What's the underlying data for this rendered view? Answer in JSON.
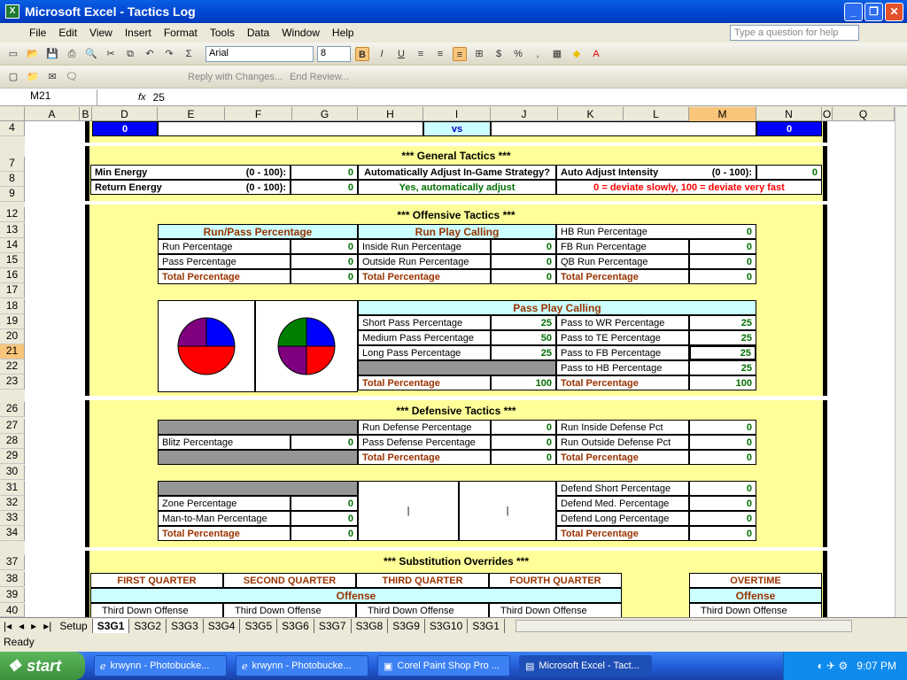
{
  "window": {
    "title": "Microsoft Excel - Tactics Log",
    "help_placeholder": "Type a question for help"
  },
  "menu": [
    "File",
    "Edit",
    "View",
    "Insert",
    "Format",
    "Tools",
    "Data",
    "Window",
    "Help"
  ],
  "toolbar": {
    "font": "Arial",
    "size": "8",
    "review": "Reply with Changes...",
    "end_review": "End Review..."
  },
  "formula": {
    "cell": "M21",
    "fx": "fx",
    "value": "25"
  },
  "columns": [
    "A",
    "B",
    "D",
    "E",
    "F",
    "G",
    "H",
    "I",
    "J",
    "K",
    "L",
    "M",
    "N",
    "O",
    "Q"
  ],
  "rows": [
    "4",
    "7",
    "8",
    "9",
    "12",
    "13",
    "14",
    "15",
    "16",
    "17",
    "18",
    "19",
    "20",
    "21",
    "22",
    "23",
    "26",
    "27",
    "28",
    "29",
    "30",
    "31",
    "32",
    "33",
    "34",
    "37",
    "38",
    "39",
    "40"
  ],
  "score": {
    "home": "0",
    "vs": "vs",
    "away": "0"
  },
  "general": {
    "title": "*** General Tactics ***",
    "min_energy": "Min Energy",
    "range1": "(0 - 100):",
    "return_energy": "Return Energy",
    "range2": "(0 - 100):",
    "min_val": "0",
    "ret_val": "0",
    "auto_q": "Automatically Adjust In-Game Strategy?",
    "auto_a": "Yes, automatically adjust",
    "intensity": "Auto Adjust Intensity",
    "range3": "(0 - 100):",
    "intensity_val": "0",
    "note": "0 = deviate slowly, 100 = deviate very fast"
  },
  "offense": {
    "title": "*** Offensive Tactics ***",
    "runpass_hdr": "Run/Pass Percentage",
    "runplay_hdr": "Run Play Calling",
    "run_pct": "Run Percentage",
    "pass_pct": "Pass Percentage",
    "total": "Total Percentage",
    "inside": "Inside Run Percentage",
    "outside": "Outside Run Percentage",
    "hb": "HB Run Percentage",
    "fb": "FB Run Percentage",
    "qb": "QB Run Percentage",
    "zero": "0",
    "pass_hdr": "Pass Play Calling",
    "short": "Short Pass Percentage",
    "medium": "Medium Pass Percentage",
    "long": "Long Pass Percentage",
    "short_v": "25",
    "medium_v": "50",
    "long_v": "25",
    "wr": "Pass to WR Percentage",
    "te": "Pass to TE Percentage",
    "fbp": "Pass to FB Percentage",
    "hbp": "Pass to HB Percentage",
    "wr_v": "25",
    "te_v": "25",
    "fb_v": "25",
    "hb_v": "25",
    "total_v": "100"
  },
  "defense": {
    "title": "*** Defensive Tactics ***",
    "run_def": "Run Defense Percentage",
    "pass_def": "Pass Defense Percentage",
    "blitz": "Blitz Percentage",
    "run_in": "Run Inside Defense Pct",
    "run_out": "Run Outside Defense Pct",
    "zone": "Zone Percentage",
    "man": "Man-to-Man Percentage",
    "short": "Defend Short Percentage",
    "med": "Defend Med. Percentage",
    "long": "Defend Long Percentage",
    "total": "Total Percentage",
    "zero": "0",
    "bar": "|"
  },
  "subs": {
    "title": "*** Substitution Overrides ***",
    "q1": "FIRST QUARTER",
    "q2": "SECOND QUARTER",
    "q3": "THIRD QUARTER",
    "q4": "FOURTH QUARTER",
    "ot": "OVERTIME",
    "offense": "Offense",
    "tdo": "Third Down Offense"
  },
  "tabs": [
    "Setup",
    "S3G1",
    "S3G2",
    "S3G3",
    "S3G4",
    "S3G5",
    "S3G6",
    "S3G7",
    "S3G8",
    "S3G9",
    "S3G10",
    "S3G1"
  ],
  "status": "Ready",
  "taskbar": {
    "start": "start",
    "t1": "krwynn - Photobucke...",
    "t2": "krwynn - Photobucke...",
    "t3": "Corel Paint Shop Pro ...",
    "t4": "Microsoft Excel - Tact...",
    "time": "9:07 PM"
  },
  "colors": {
    "pie_blue": "#0000ff",
    "pie_red": "#ff0000",
    "pie_purple": "#800080",
    "pie_green": "#008000"
  }
}
